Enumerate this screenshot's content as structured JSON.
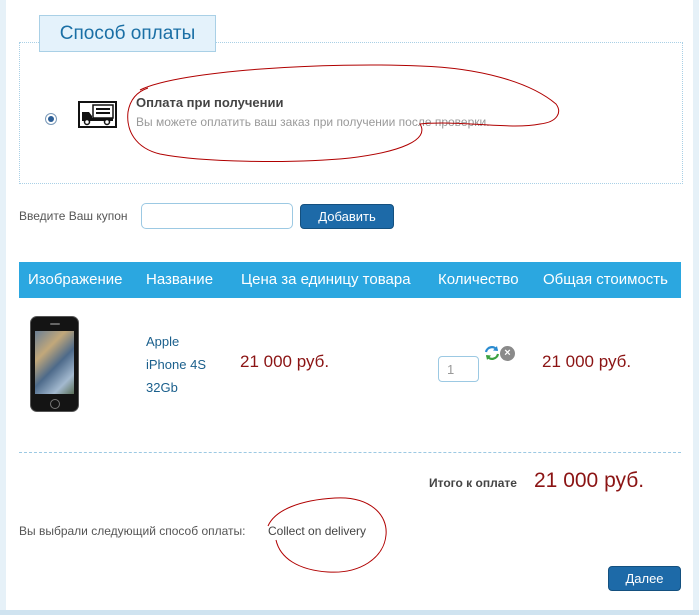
{
  "payment": {
    "section_title": "Способ оплаты",
    "method_title": "Оплата при получении",
    "method_description": "Вы можете оплатить ваш заказ при получении после проверки.",
    "selected": true,
    "method_icon": "truck-icon"
  },
  "coupon": {
    "label": "Введите Ваш купон",
    "value": "",
    "button_label": "Добавить"
  },
  "cart": {
    "headers": [
      "Изображение",
      "Название",
      "Цена за единицу товара",
      "Количество",
      "Общая стоимость"
    ],
    "items": [
      {
        "name_lines": [
          "Apple",
          "iPhone 4S",
          "32Gb"
        ],
        "unit_price": "21 000 руб.",
        "quantity": "1",
        "total": "21 000 руб."
      }
    ]
  },
  "summary": {
    "total_label": "Итого к оплате",
    "total_value": "21 000 руб.",
    "chosen_method_label": "Вы выбрали следующий способ оплаты:",
    "chosen_method_value": "Collect on delivery"
  },
  "actions": {
    "next_label": "Далее"
  },
  "colors": {
    "accent": "#2ba7e0",
    "button": "#1d6aa8",
    "price": "#8b1414",
    "annotation": "#b00000"
  }
}
